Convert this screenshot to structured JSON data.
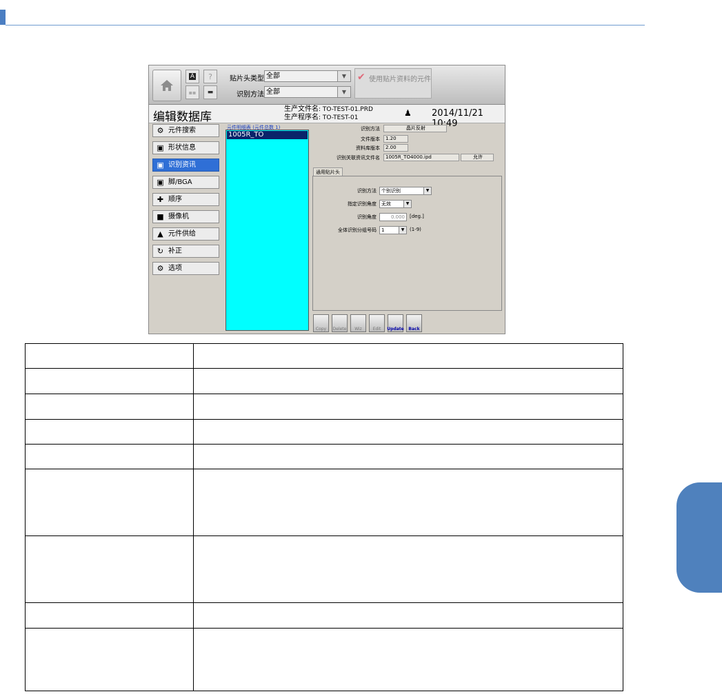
{
  "colors": {
    "accent": "#4f81bd",
    "selected_menu": "#2f6fd6",
    "list_bg": "#00ffff"
  },
  "toolbar": {
    "head_type_label": "贴片头类型",
    "head_type_value": "全部",
    "recog_method_label": "识别方法",
    "recog_method_value": "全部",
    "use_part_data_label": "使用贴片资料的元件",
    "icons": [
      "home-icon",
      "font-icon",
      "help-icon",
      "people-icon",
      "machine-icon"
    ]
  },
  "header": {
    "title": "编辑数据库",
    "prod_file_label": "生产文件名",
    "prod_file_value": ": TO-TEST-01.PRD",
    "prod_prog_label": "生产程序名",
    "prod_prog_value": ": TO-TEST-01",
    "datetime": "2014/11/21 10:49"
  },
  "menu": [
    {
      "label": "元件搜索",
      "icon": "part-search-icon"
    },
    {
      "label": "形状信息",
      "icon": "shape-icon"
    },
    {
      "label": "识别资讯",
      "icon": "recognition-icon",
      "selected": true
    },
    {
      "label": "脚/BGA",
      "icon": "lead-icon"
    },
    {
      "label": "顺序",
      "icon": "sequence-icon"
    },
    {
      "label": "摄像机",
      "icon": "camera-icon"
    },
    {
      "label": "元件供给",
      "icon": "feeder-icon"
    },
    {
      "label": "补正",
      "icon": "correction-icon"
    },
    {
      "label": "选项",
      "icon": "options-icon"
    }
  ],
  "part_list": {
    "header": "元件明细表 (元件总数 1)",
    "items": [
      "1005R_TO"
    ]
  },
  "info": {
    "method_label": "识别方法",
    "method_value": "晶片反射",
    "file_ver_label": "文件版本",
    "file_ver_value": "1.20",
    "db_ver_label": "资料库版本",
    "db_ver_value": "2.00",
    "assoc_file_label": "识别关联资讯文件名",
    "assoc_file_value": "1005R_TO4000.ipd",
    "assoc_btn": "允许"
  },
  "tab": {
    "label": "通用贴片头"
  },
  "form": {
    "method_label": "识别方法",
    "method_value": "个别识别",
    "angle_spec_label": "指定识别角度",
    "angle_spec_value": "无效",
    "angle_label": "识别角度",
    "angle_value": "0.000",
    "angle_unit": "[deg.]",
    "group_label": "全体识别分组号码",
    "group_value": "1",
    "group_range": "(1-9)"
  },
  "bottom_buttons": [
    "Copy",
    "Delete",
    "Wiz",
    "Edit",
    "Update",
    "Back"
  ],
  "table_rows": 9
}
